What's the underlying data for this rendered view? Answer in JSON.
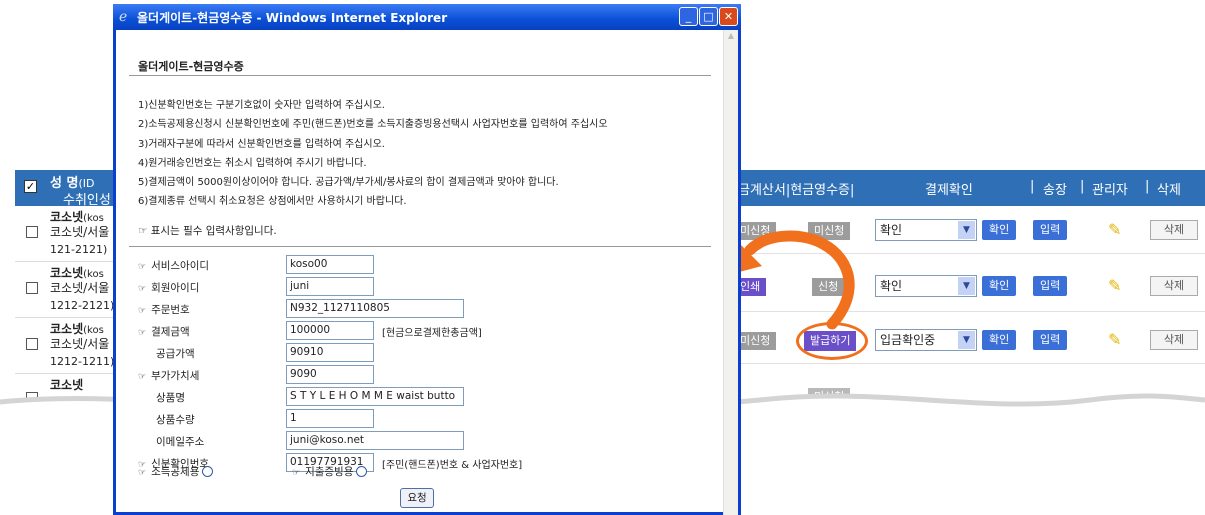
{
  "background_table": {
    "header": {
      "name_label": "성 명",
      "id_label": "(ID",
      "receiver_label": "수취인성",
      "invoice_label": "금계산서|현금영수증|",
      "payment_confirm": "결제확인",
      "sep1": "|",
      "shipping": "송장",
      "sep2": "|",
      "admin": "관리자",
      "sep3": "|",
      "delete": "삭제"
    },
    "rows": [
      {
        "name": "코소넷",
        "name_suffix": "(kos",
        "addr": "코소넷/서울",
        "code": "121-2121)"
      },
      {
        "name": "코소넷",
        "name_suffix": "(kos",
        "addr": "코소넷/서울",
        "code": "1212-2121)"
      },
      {
        "name": "코소넷",
        "name_suffix": "(kos",
        "addr": "코소넷/서울",
        "code": "1212-1211)"
      },
      {
        "name": "코소넷",
        "name_suffix": "",
        "addr": "",
        "code": ""
      }
    ],
    "right_rows": [
      {
        "status_a": "미신청",
        "status_b": "미신청",
        "select": "확인",
        "btn1": "확인",
        "btn2": "입력",
        "del": "삭제"
      },
      {
        "status_a": "인쇄",
        "status_b": "신청",
        "select": "확인",
        "btn1": "확인",
        "btn2": "입력",
        "del": "삭제"
      },
      {
        "status_a": "미신청",
        "status_b": "발급하기",
        "select": "입금확인중",
        "btn1": "확인",
        "btn2": "입력",
        "del": "삭제"
      },
      {
        "status_a": "",
        "status_b": "미신청",
        "select": "",
        "btn1": "",
        "btn2": "",
        "del": ""
      }
    ]
  },
  "popup": {
    "window_title": "올더게이트-현금영수증 - Windows Internet Explorer",
    "heading": "올더게이트-현금영수증",
    "notes": [
      "1)신분확인번호는 구분기호없이 숫자만 입력하여 주십시오.",
      "2)소득공제용신청시 신분확인번호에 주민(핸드폰)번호를 소득지출증빙용선택시 사업자번호를 입력하여 주십시오",
      "3)거래자구분에 따라서 신분확인번호를 입력하여 주십시오.",
      "4)원거래승인번호는 취소시 입력하여 주시기 바랍니다.",
      "5)결제금액이 5000원이상이어야 합니다. 공급가액/부가세/봉사료의 합이 결제금액과 맞아야 합니다.",
      "6)결제종류 선택시 취소요청은 상점에서만 사용하시기 바랍니다."
    ],
    "required_note": "표시는 필수 입력사항입니다.",
    "required_mark": "☞",
    "fields": {
      "service_id": {
        "label": "서비스아이디",
        "value": "koso00"
      },
      "member_id": {
        "label": "회원아이디",
        "value": "juni"
      },
      "order_no": {
        "label": "주문번호",
        "value": "N932_1127110805"
      },
      "amount": {
        "label": "결제금액",
        "value": "100000",
        "hint": "[현금으로결제한총금액]"
      },
      "supply": {
        "label": "공급가액",
        "value": "90910"
      },
      "vat": {
        "label": "부가가치세",
        "value": "9090"
      },
      "product": {
        "label": "상품명",
        "value": "S T Y L E H O M M E waist butto"
      },
      "quantity": {
        "label": "상품수량",
        "value": "1"
      },
      "email": {
        "label": "이메일주소",
        "value": "juni@koso.net"
      },
      "id_no": {
        "label": "신분확인번호",
        "value": "01197791931",
        "hint": "[주민(핸드폰)번호 & 사업자번호]"
      }
    },
    "radio_income": "소득공제용",
    "radio_expense": "지출증빙용",
    "submit_label": "요청"
  },
  "colors": {
    "accent_orange": "#f0701e",
    "header_blue": "#2f6fb6",
    "button_blue": "#3a6fd8",
    "title_blue": "#0a4fd6"
  }
}
